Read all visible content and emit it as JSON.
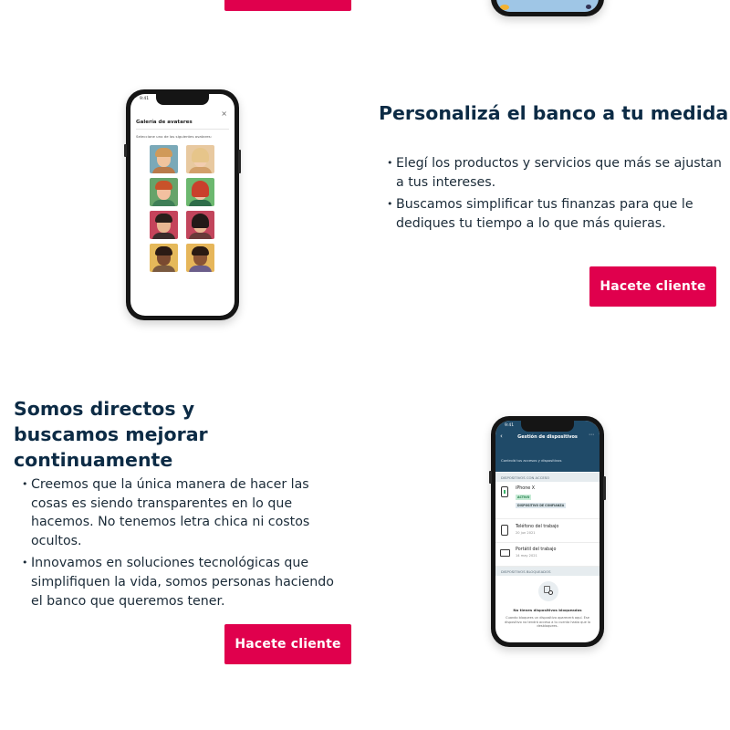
{
  "colors": {
    "accent": "#e0004d",
    "heading": "#0c2b45",
    "text": "#1b2b38"
  },
  "top": {
    "cta_label": ""
  },
  "section1": {
    "title": "Personalizá el banco a tu medida",
    "bullets": [
      "Elegí los productos y servicios que más se ajustan a tus intereses.",
      "Buscamos simplificar tus finanzas para que le dediques tu tiempo a lo que más quieras."
    ],
    "cta_label": "Hacete cliente",
    "phone": {
      "time": "9:41",
      "screen_title": "Galería de avatares",
      "close_icon": "close-icon",
      "subtitle": "Seleccione uno de los siguientes avatares:"
    }
  },
  "section2": {
    "title": "Somos directos y buscamos mejorar continuamente",
    "bullets": [
      "Creemos que la única manera de hacer las cosas es siendo transparentes en lo que hacemos. No tenemos letra chica ni costos ocultos.",
      "Innovamos en soluciones tecnológicas que simplifiquen la vida, somos personas haciendo el banco que queremos tener."
    ],
    "cta_label": "Hacete cliente",
    "phone": {
      "time": "9:41",
      "screen_title": "Gestión de dispositivos",
      "intro": "Controlá tus accesos y dispositivos",
      "section_access": "DISPOSITIVOS CON ACCESO",
      "devices": [
        {
          "name": "iPhone X",
          "badges": [
            "ACTIVO",
            "DISPOSITIVO DE CONFIANZA"
          ],
          "date": ""
        },
        {
          "name": "Teléfono del trabajo",
          "badges": [],
          "date": "20 jun 2021"
        },
        {
          "name": "Portátil del trabajo",
          "badges": [],
          "date": "14 may 2021"
        }
      ],
      "section_blocked": "DISPOSITIVOS BLOQUEADOS",
      "empty_title": "No tienes dispositivos bloqueados",
      "empty_text": "Cuando bloquees un dispositivo aparecerá aquí. Ese dispositivo no tendrá acceso a tu cuenta hasta que lo desbloquees."
    }
  }
}
